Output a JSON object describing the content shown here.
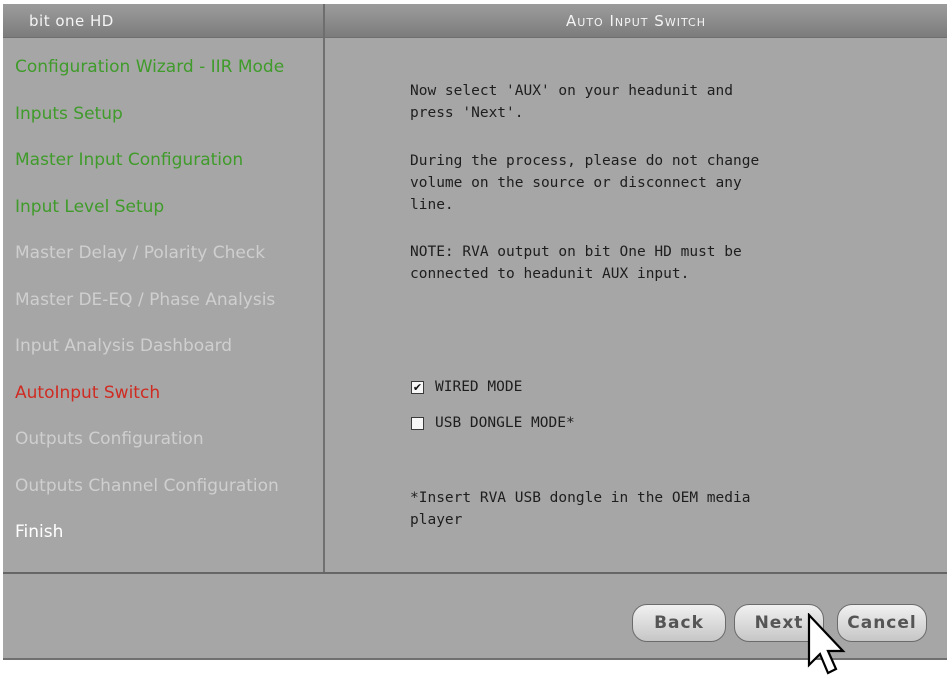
{
  "app": {
    "title": "bit one HD",
    "page_title": "Auto Input Switch"
  },
  "sidebar": {
    "items": [
      {
        "label": "Configuration Wizard - IIR Mode",
        "status": "done"
      },
      {
        "label": "Inputs Setup",
        "status": "done"
      },
      {
        "label": "Master Input Configuration",
        "status": "done"
      },
      {
        "label": "Input Level Setup",
        "status": "done"
      },
      {
        "label": "Master Delay / Polarity Check",
        "status": "pending"
      },
      {
        "label": "Master DE-EQ / Phase Analysis",
        "status": "pending"
      },
      {
        "label": "Input Analysis Dashboard",
        "status": "pending"
      },
      {
        "label": "AutoInput Switch",
        "status": "current"
      },
      {
        "label": "Outputs Configuration",
        "status": "pending"
      },
      {
        "label": "Outputs Channel Configuration",
        "status": "pending"
      },
      {
        "label": "Finish",
        "status": "finish"
      }
    ]
  },
  "content": {
    "instruction": "Now select 'AUX' on your headunit and\npress 'Next'.",
    "warning": "During the process, please do not change\nvolume on the source or disconnect any\nline.",
    "note": "NOTE: RVA output on bit One HD must be\nconnected to headunit AUX input.",
    "options": [
      {
        "label": "WIRED MODE",
        "checked": true
      },
      {
        "label": "USB DONGLE MODE*",
        "checked": false
      }
    ],
    "footnote": "*Insert RVA USB dongle in the OEM media\nplayer"
  },
  "footer": {
    "back_label": "Back",
    "next_label": "Next",
    "cancel_label": "Cancel"
  },
  "colors": {
    "done": "#3f9b2a",
    "pending": "#cfcfcf",
    "current": "#cf2b22",
    "finish": "#ffffff",
    "panel": "#a6a6a6"
  }
}
